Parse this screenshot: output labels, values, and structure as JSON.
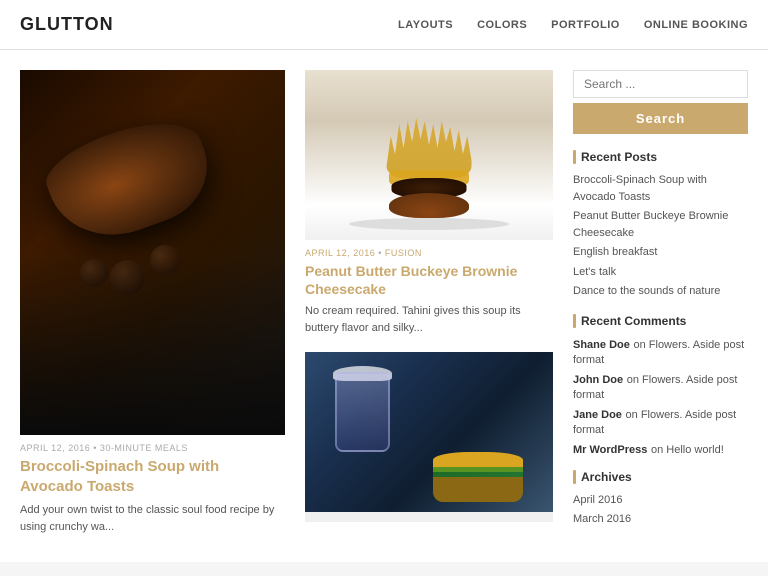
{
  "header": {
    "logo": "GLUTTON",
    "nav": [
      {
        "label": "LAYOUTS",
        "href": "#"
      },
      {
        "label": "COLORS",
        "href": "#"
      },
      {
        "label": "PORTFOLIO",
        "href": "#"
      },
      {
        "label": "ONLINE BOOKING",
        "href": "#"
      }
    ]
  },
  "featured_post": {
    "meta": "APRIL 12, 2016 • 30-MINUTE MEALS",
    "title": "Broccoli-Spinach Soup with Avocado Toasts",
    "excerpt": "Add your own twist to the classic soul food recipe by using crunchy wa..."
  },
  "center_post_top": {
    "meta_date": "APRIL 12, 2016",
    "meta_category": "FUSION",
    "title": "Peanut Butter Buckeye Brownie Cheesecake",
    "excerpt": "No cream required. Tahini gives this soup its buttery flavor and silky..."
  },
  "sidebar": {
    "search_placeholder": "Search ...",
    "search_button_label": "Search",
    "recent_posts_title": "Recent Posts",
    "recent_posts": [
      "Broccoli-Spinach Soup with Avocado Toasts",
      "Peanut Butter Buckeye Brownie Cheesecake",
      "English breakfast",
      "Let's talk",
      "Dance to the sounds of nature"
    ],
    "recent_comments_title": "Recent Comments",
    "recent_comments": [
      {
        "author": "Shane Doe",
        "text": "on Flowers. Aside post format"
      },
      {
        "author": "John Doe",
        "text": "on Flowers. Aside post format"
      },
      {
        "author": "Jane Doe",
        "text": "on Flowers. Aside post format"
      },
      {
        "author": "Mr WordPress",
        "text": "on Hello world!"
      }
    ],
    "archives_title": "Archives",
    "archives": [
      "April 2016",
      "March 2016"
    ]
  },
  "colors": {
    "accent": "#c9a96e",
    "text_primary": "#333",
    "text_muted": "#aaa",
    "link": "#c9a96e"
  }
}
